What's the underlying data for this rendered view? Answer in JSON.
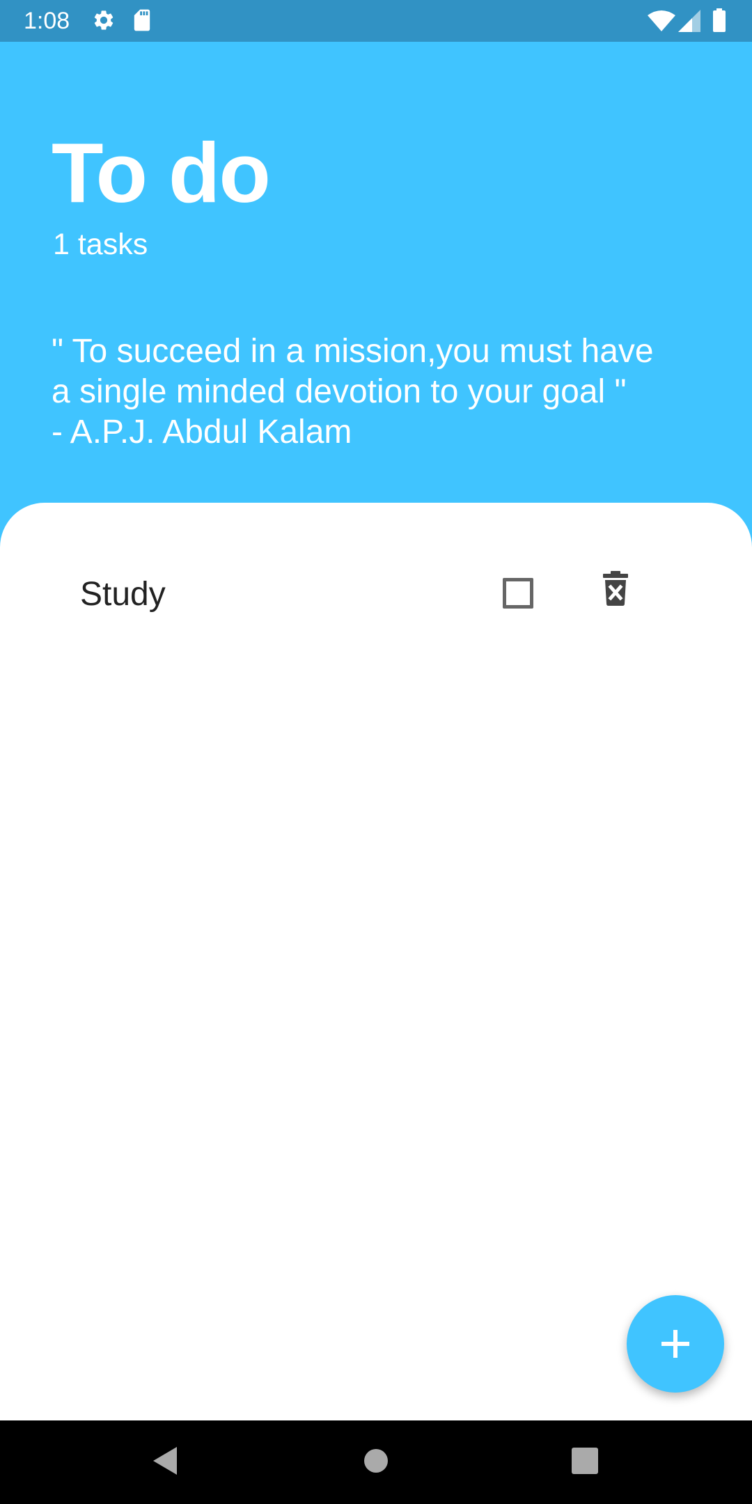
{
  "status_bar": {
    "time": "1:08",
    "icons": [
      "gear-icon",
      "sd-card-icon",
      "wifi-icon",
      "signal-icon",
      "battery-icon"
    ],
    "background": "#3192C4"
  },
  "header": {
    "title": "To do",
    "task_count": "1 tasks",
    "quote_lines": [
      "\" To succeed in a mission,you must have",
      "a single minded devotion to your goal \"",
      "-  A.P.J. Abdul Kalam"
    ],
    "background": "#40C4FF"
  },
  "tasks": [
    {
      "label": "Study",
      "checked": false,
      "checkbox_icon": "checkbox-unchecked-icon",
      "delete_icon": "trash-icon"
    }
  ],
  "fab": {
    "icon": "plus-icon",
    "color": "#40C4FF"
  },
  "nav_bar": {
    "buttons": [
      "back-icon",
      "home-icon",
      "recents-icon"
    ]
  }
}
